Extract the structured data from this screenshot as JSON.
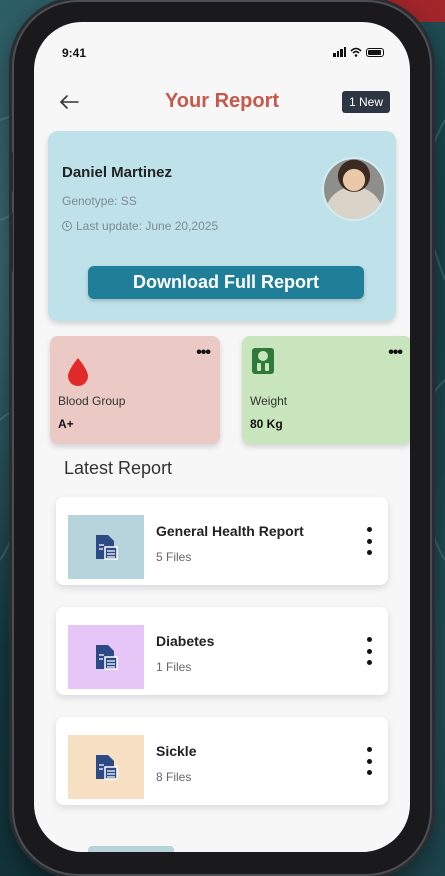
{
  "status_bar": {
    "time": "9:41"
  },
  "header": {
    "title": "Your Report",
    "badge": "1 New"
  },
  "profile": {
    "name": "Daniel Martinez",
    "genotype": "Genotype: SS",
    "last_update": "Last update: June 20,2025",
    "download_label": "Download Full Report"
  },
  "stats": [
    {
      "label": "Blood Group",
      "value": "A+",
      "icon": "blood-drop-icon"
    },
    {
      "label": "Weight",
      "value": "80 Kg",
      "icon": "weight-scale-icon"
    }
  ],
  "section_title": "Latest Report",
  "reports": [
    {
      "title": "General Health Report",
      "files": "5 Files",
      "color": "#b7d3db"
    },
    {
      "title": "Diabetes",
      "files": "1 Files",
      "color": "#e6c6f6"
    },
    {
      "title": "Sickle",
      "files": "8 Files",
      "color": "#f6dfc2"
    }
  ],
  "colors": {
    "accent": "#1f7e98",
    "title": "#c8584c",
    "card": "#bfe2ea"
  }
}
